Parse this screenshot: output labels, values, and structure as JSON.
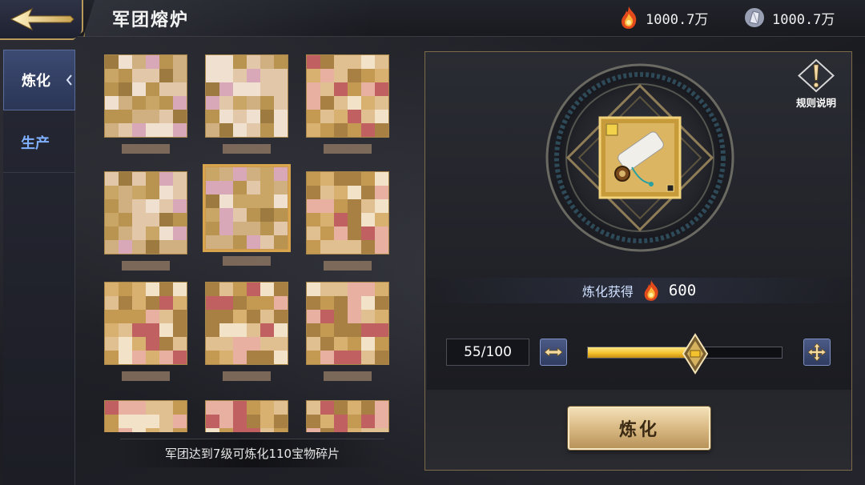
{
  "header": {
    "title": "军团熔炉",
    "currencies": [
      {
        "icon": "flame-essence-icon",
        "value": "1000.7万"
      },
      {
        "icon": "crystal-shard-icon",
        "value": "1000.7万"
      }
    ]
  },
  "sidebar": {
    "tabs": [
      {
        "label": "炼化",
        "active": true
      },
      {
        "label": "生产",
        "active": false
      }
    ]
  },
  "grid": {
    "rows_visible": 3,
    "columns": 3,
    "items_note": "pixelated treasure fragments",
    "selected_index": 4
  },
  "hint_text": "军团达到7级可炼化110宝物碎片",
  "panel": {
    "rules_label": "规则说明",
    "selected_item_icon": "scroll-fragment-icon",
    "yield_label": "炼化获得",
    "yield_value": "600",
    "quantity_text": "55/100",
    "quantity_current": 55,
    "quantity_max": 100,
    "refine_label": "炼化"
  },
  "colors": {
    "accent_gold": "#d9b983",
    "tab_blue": "#7fb0ff",
    "slider_fill": "#f4c22e"
  }
}
